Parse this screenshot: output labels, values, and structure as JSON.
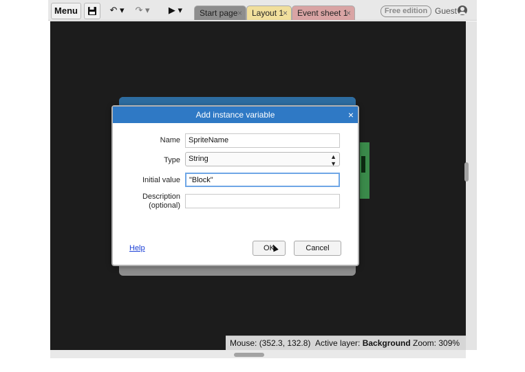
{
  "toolbar": {
    "menu_label": "Menu",
    "save_icon": "floppy-disk-icon",
    "undo_icon": "↶ ▾",
    "redo_icon": "↷ ▾",
    "play_icon": "▶ ▾",
    "tabs": [
      {
        "label": "Start page",
        "close": "×"
      },
      {
        "label": "Layout 1",
        "close": "×"
      },
      {
        "label": "Event sheet 1",
        "close": "×"
      }
    ],
    "edition_badge": "Free edition",
    "user_label": "Guest"
  },
  "dialog": {
    "title": "Add instance variable",
    "close": "×",
    "fields": {
      "name_label": "Name",
      "name_value": "SpriteName",
      "type_label": "Type",
      "type_value": "String",
      "initial_label": "Initial value",
      "initial_value": "\"Block\"",
      "description_label_1": "Description",
      "description_label_2": "(optional)",
      "description_value": ""
    },
    "help_label": "Help",
    "ok_label": "OK",
    "cancel_label": "Cancel"
  },
  "statusbar": {
    "mouse_prefix": "Mouse: ",
    "mouse_value": "(352.3, 132.8)",
    "layer_prefix": "Active layer: ",
    "layer_value": "Background",
    "zoom_prefix": "Zoom: ",
    "zoom_value": "309%"
  },
  "colors": {
    "dialog_title_bg": "#2f79c5",
    "canvas_bg": "#1c1c1c",
    "tab_layout": "#f1df9c",
    "tab_events": "#d9a4a4"
  }
}
